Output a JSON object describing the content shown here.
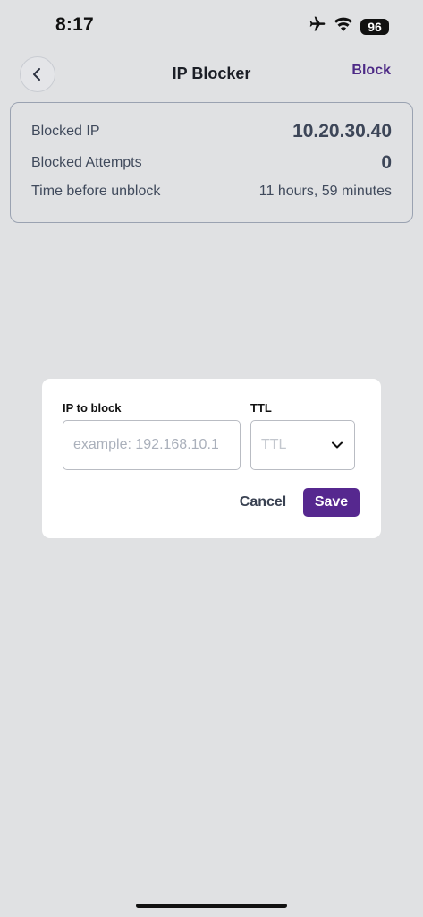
{
  "status_bar": {
    "time": "8:17",
    "battery": "96",
    "icons": [
      "airplane-icon",
      "wifi-icon",
      "battery-icon"
    ]
  },
  "header": {
    "title": "IP Blocker",
    "action_label": "Block",
    "back_icon": "chevron-left-icon"
  },
  "info": {
    "rows": [
      {
        "label": "Blocked IP",
        "value": "10.20.30.40"
      },
      {
        "label": "Blocked Attempts",
        "value": "0"
      },
      {
        "label": "Time before unblock",
        "value": "11 hours, 59 minutes"
      }
    ]
  },
  "modal": {
    "ip_label": "IP to block",
    "ip_placeholder": "example: 192.168.10.1",
    "ip_value": "",
    "ttl_label": "TTL",
    "ttl_placeholder": "TTL",
    "cancel_label": "Cancel",
    "save_label": "Save"
  },
  "colors": {
    "accent": "#56288f",
    "background": "#e0e1e3"
  }
}
